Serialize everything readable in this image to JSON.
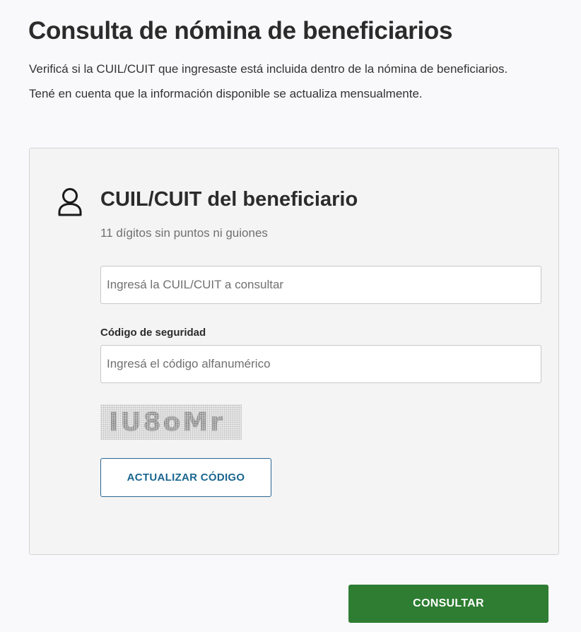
{
  "page": {
    "title": "Consulta de nómina de beneficiarios",
    "intro_line_1": "Verificá si la CUIL/CUIT que ingresaste está incluida dentro de la nómina de beneficiarios.",
    "intro_line_2": "Tené en cuenta que la información disponible se actualiza mensualmente."
  },
  "form": {
    "section_icon": "user-outline-icon",
    "section_title": "CUIL/CUIT del beneficiario",
    "section_help": "11 dígitos sin puntos ni guiones",
    "cuil_input": {
      "value": "",
      "placeholder": "Ingresá la CUIL/CUIT a consultar"
    },
    "security_code": {
      "label": "Código de seguridad",
      "value": "",
      "placeholder": "Ingresá el código alfanumérico"
    },
    "captcha": {
      "text": "IU8oMr"
    },
    "refresh_label": "ACTUALIZAR CÓDIGO",
    "submit_label": "CONSULTAR"
  },
  "colors": {
    "background": "#f9f9fb",
    "card_background": "#f4f4f4",
    "primary_green": "#2e7d32",
    "link_blue": "#1a6690",
    "text_dark": "#2b2b2b",
    "text_muted": "#707070"
  }
}
